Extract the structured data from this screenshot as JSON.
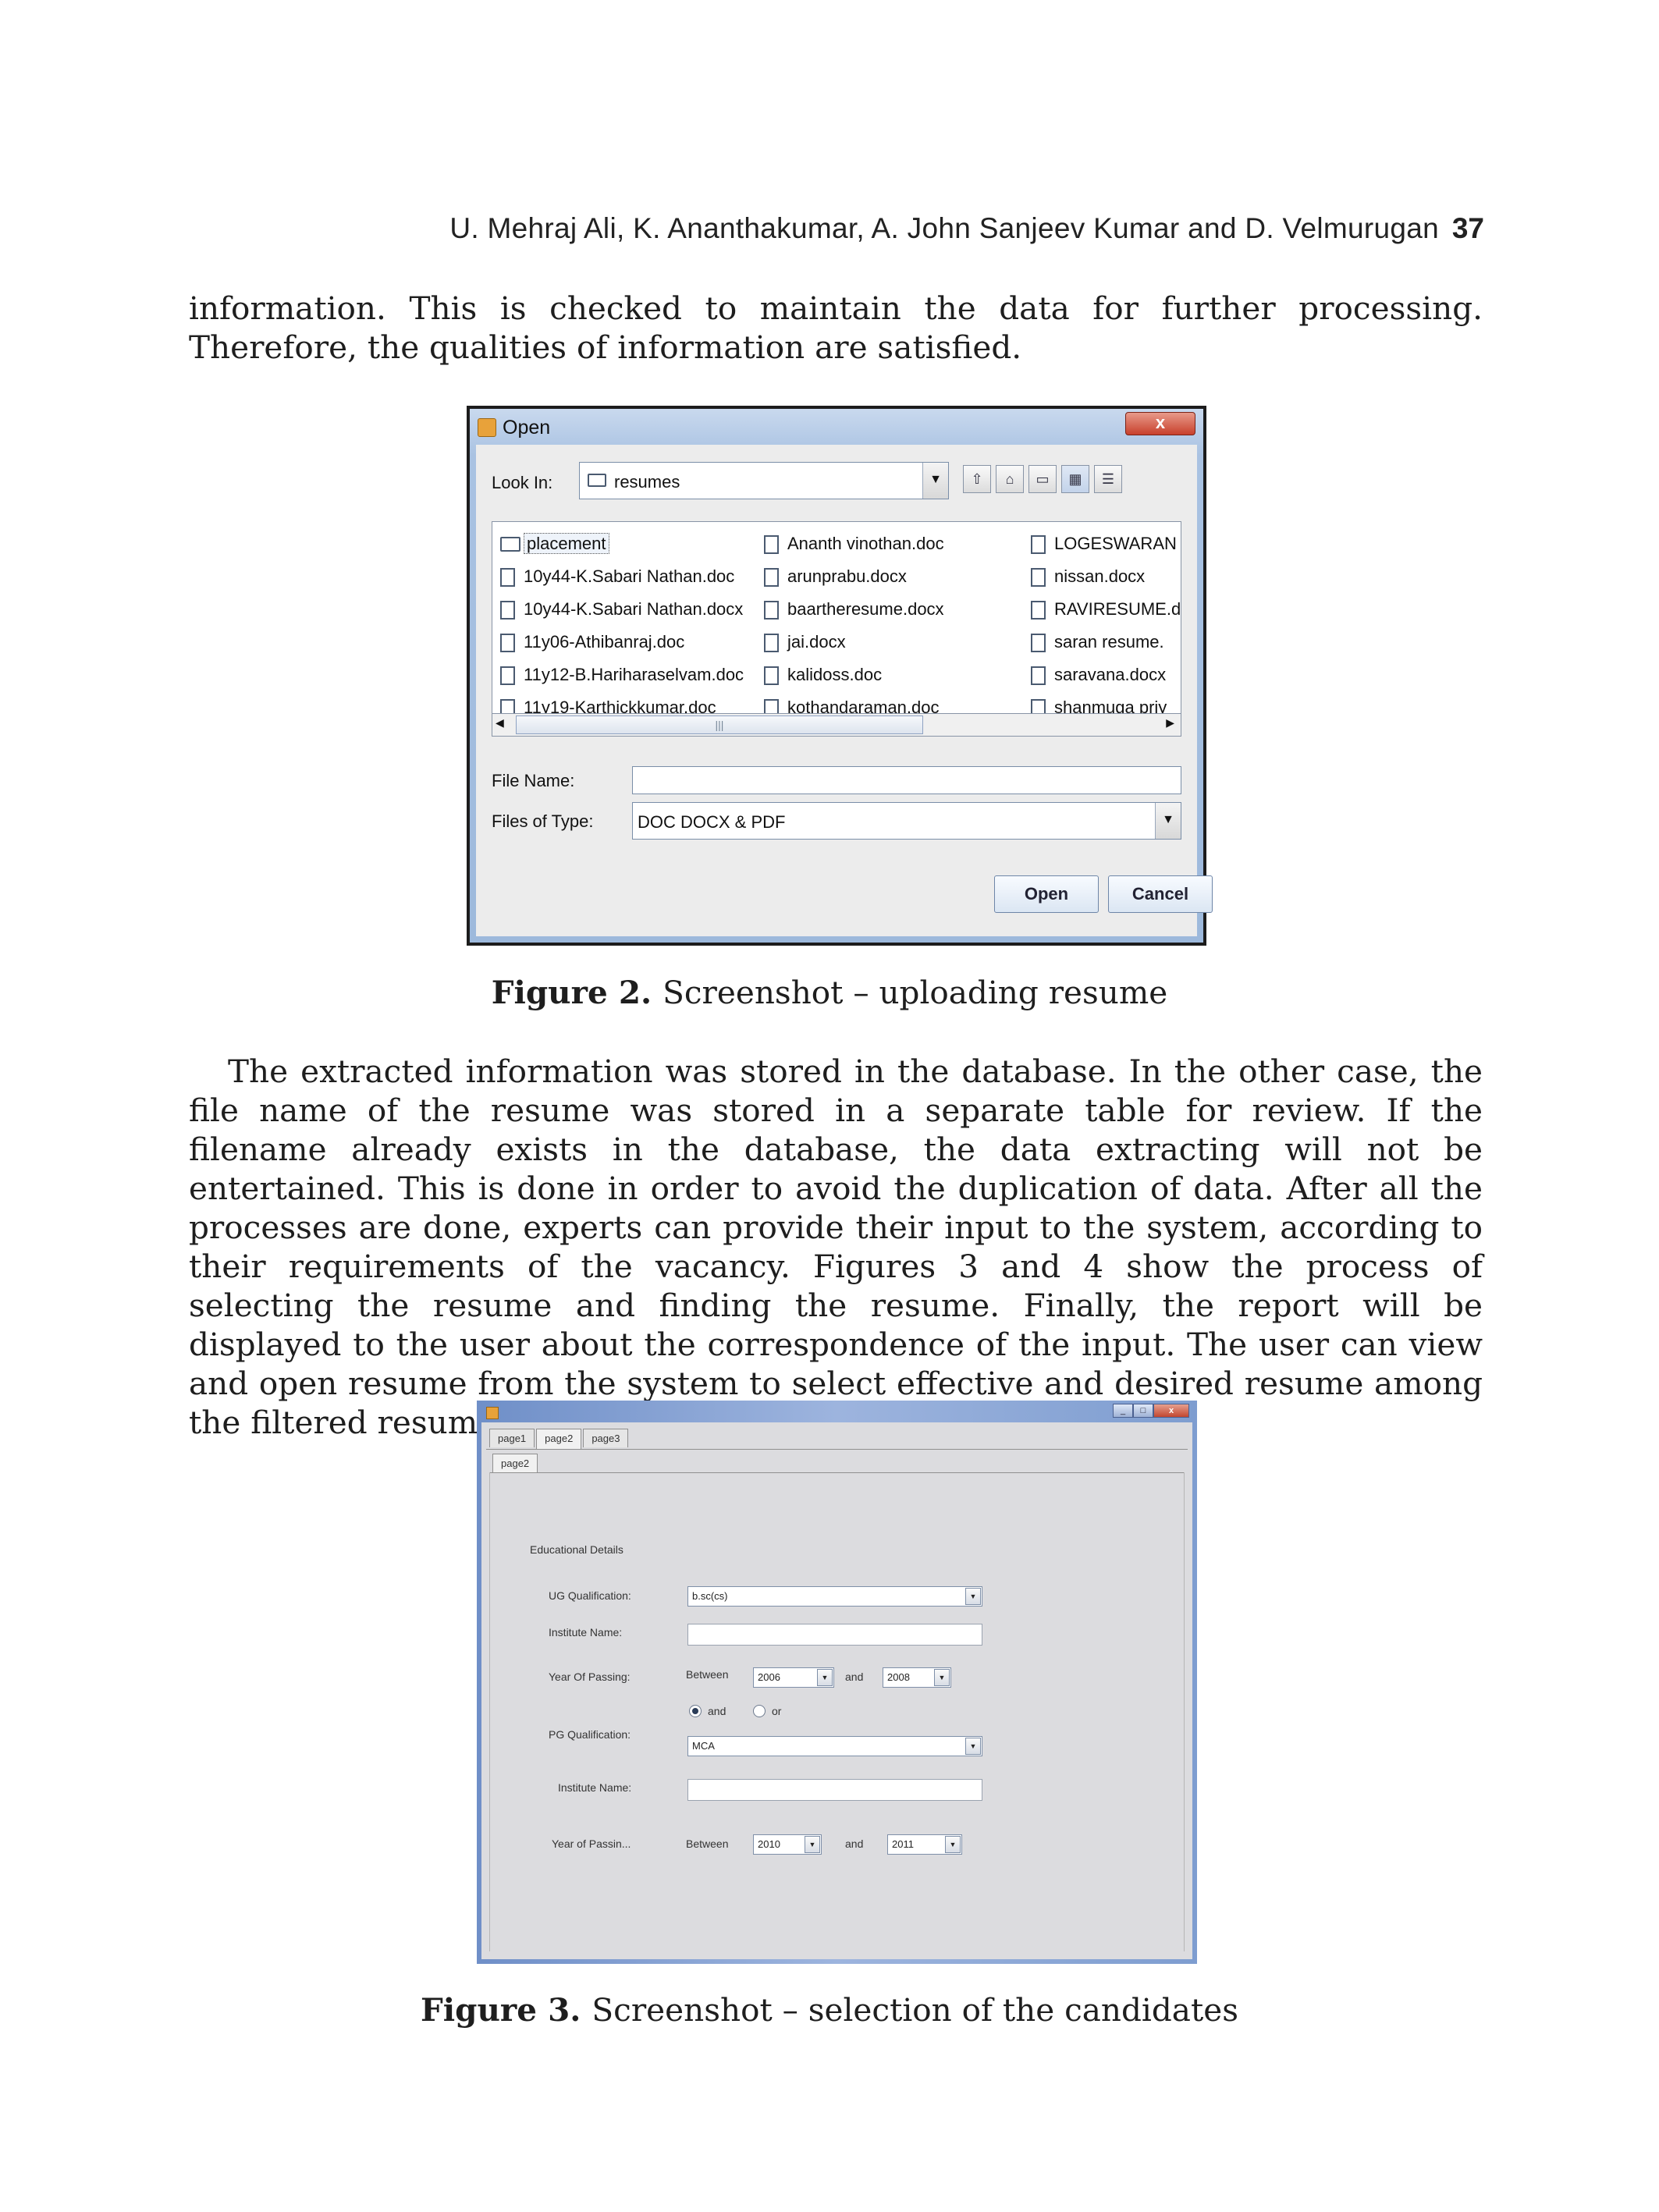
{
  "header": {
    "authors": "U. Mehraj Ali, K. Ananthakumar, A. John Sanjeev Kumar and D. Velmurugan",
    "page_number": "37"
  },
  "para1": "information. This is checked to maintain the data for further processing. Therefore, the qualities of information are satisfied.",
  "figure2": {
    "caption_label": "Figure 2.",
    "caption_text": "Screenshot – uploading resume",
    "dialog": {
      "title": "Open",
      "close_label": "x",
      "look_in_label": "Look In:",
      "look_in_value": "resumes",
      "file_name_label": "File Name:",
      "file_name_value": "",
      "files_of_type_label": "Files of Type:",
      "files_of_type_value": "DOC DOCX & PDF",
      "open_label": "Open",
      "cancel_label": "Cancel",
      "columns": [
        [
          "placement",
          "10y44-K.Sabari Nathan.doc",
          "10y44-K.Sabari Nathan.docx",
          "11y06-Athibanraj.doc",
          "11y12-B.Hariharaselvam.doc",
          "11y19-Karthickkumar.doc"
        ],
        [
          "Ananth vinothan.doc",
          "arunprabu.docx",
          "baartheresume.docx",
          "jai.docx",
          "kalidoss.doc",
          "kothandaraman.doc"
        ],
        [
          "LOGESWARAN",
          "nissan.docx",
          "RAVIRESUME.d",
          "saran resume.",
          "saravana.docx",
          "shanmuga priy"
        ]
      ]
    }
  },
  "para2": "The extracted information was stored in the database. In the other case, the file name of the resume was stored in a separate table for review. If the filename already exists in the database, the data extracting will not be entertained. This is done in order to avoid the duplication of data. After all the processes are done, experts can provide their input to the system, according to their requirements of the vacancy. Figures 3 and 4 show the process of selecting the resume and finding the resume. Finally, the report will be displayed to the user about the correspondence of the input. The user can view and open resume from the system to select effective and desired resume among the filtered resume.",
  "figure3": {
    "caption_label": "Figure 3.",
    "caption_text": "Screenshot – selection of the candidates",
    "tabs": [
      "page1",
      "page2",
      "page3"
    ],
    "inner_tab": "page2",
    "section_title": "Educational Details",
    "ug_label": "UG Qualification:",
    "ug_value": "b.sc(cs)",
    "ug_institute_label": "Institute Name:",
    "ug_year_label": "Year Of Passing:",
    "between_label": "Between",
    "and_label": "and",
    "ug_year_from": "2006",
    "ug_year_to": "2008",
    "radio_and_label": "and",
    "radio_or_label": "or",
    "pg_label": "PG Qualification:",
    "pg_value": "MCA",
    "pg_institute_label": "Institute Name:",
    "pg_year_label": "Year of Passin...",
    "pg_year_from": "2010",
    "pg_year_to": "2011"
  }
}
